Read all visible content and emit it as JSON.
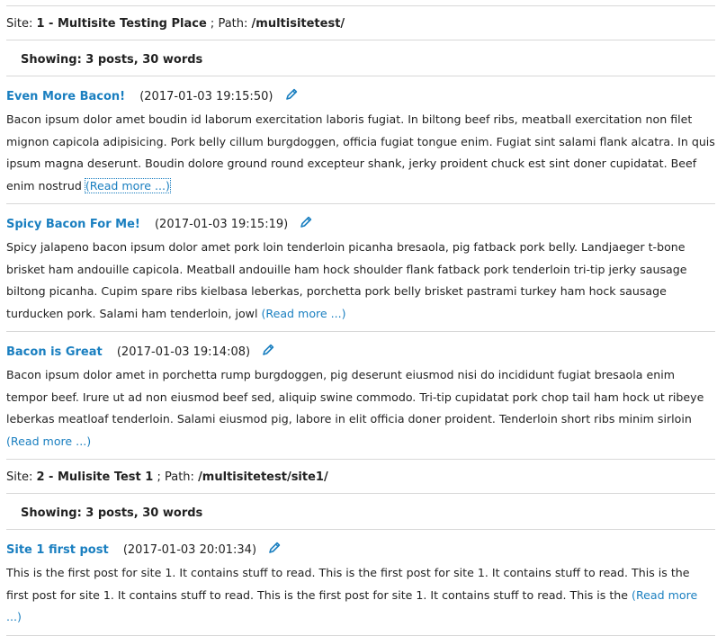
{
  "sites": [
    {
      "site_label": "Site:",
      "site_id": "1",
      "site_name_prefix": " - ",
      "site_name": "Multisite Testing Place",
      "path_label": " ; Path:",
      "path": "/multisitetest/",
      "showing": "Showing: 3 posts, 30 words",
      "posts": [
        {
          "title": "Even More Bacon!",
          "date": "(2017-01-03 19:15:50)",
          "body": "Bacon ipsum dolor amet boudin id laborum exercitation laboris fugiat. In biltong beef ribs, meatball exercitation non filet mignon capicola adipisicing. Pork belly cillum burgdoggen, officia fugiat tongue enim. Fugiat sint salami flank alcatra. In quis ipsum magna deserunt. Boudin dolore ground round excepteur shank, jerky proident chuck est sint doner cupidatat. Beef enim nostrud ",
          "read_more": "(Read more ...)"
        },
        {
          "title": "Spicy Bacon For Me!",
          "date": "(2017-01-03 19:15:19)",
          "body": "Spicy jalapeno bacon ipsum dolor amet pork loin tenderloin picanha bresaola, pig fatback pork belly. Landjaeger t-bone brisket ham andouille capicola. Meatball andouille ham hock shoulder flank fatback pork tenderloin tri-tip jerky sausage biltong picanha. Cupim spare ribs kielbasa leberkas, porchetta pork belly brisket pastrami turkey ham hock sausage turducken pork. Salami ham tenderloin, jowl ",
          "read_more": "(Read more ...)"
        },
        {
          "title": "Bacon is Great",
          "date": "(2017-01-03 19:14:08)",
          "body": "Bacon ipsum dolor amet in porchetta rump burgdoggen, pig deserunt eiusmod nisi do incididunt fugiat bresaola enim tempor beef. Irure ut ad non eiusmod beef sed, aliquip swine commodo. Tri-tip cupidatat pork chop tail ham hock ut ribeye leberkas meatloaf tenderloin. Salami eiusmod pig, labore in elit officia doner proident. Tenderloin short ribs minim sirloin ",
          "read_more": "(Read more ...)"
        }
      ]
    },
    {
      "site_label": "Site:",
      "site_id": "2",
      "site_name_prefix": " - ",
      "site_name": "Mulisite Test 1",
      "path_label": " ; Path:",
      "path": "/multisitetest/site1/",
      "showing": "Showing: 3 posts, 30 words",
      "posts": [
        {
          "title": "Site 1 first post",
          "date": "(2017-01-03 20:01:34)",
          "body": "This is the first post for site 1. It contains stuff to read. This is the first post for site 1. It contains stuff to read. This is the first post for site 1. It contains stuff to read. This is the first post for site 1. It contains stuff to read. This is the ",
          "read_more": "(Read more ...)"
        }
      ]
    }
  ],
  "icons": {
    "edit": "pencil-icon"
  },
  "colors": {
    "link": "#1a7fc0",
    "rule": "#d8d8d8"
  }
}
